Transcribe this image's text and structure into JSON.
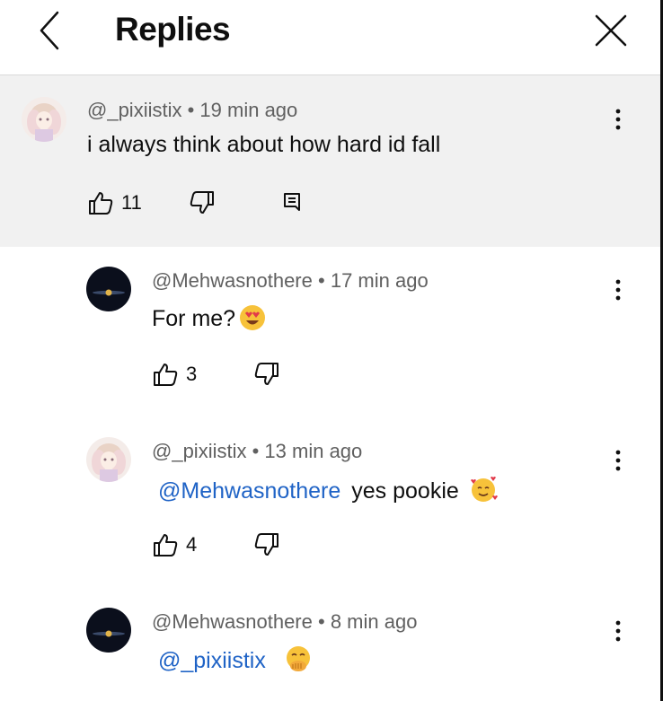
{
  "header": {
    "title": "Replies"
  },
  "comments": [
    {
      "author": "@_pixiistix",
      "time": "19 min ago",
      "text": "i always think about how hard id fall",
      "likes": "11",
      "avatar": "pastel-anime-avatar"
    },
    {
      "author": "@Mehwasnothere",
      "time": "17 min ago",
      "text": "For me?",
      "emoji": "heart-eyes-emoji",
      "likes": "3",
      "avatar": "dark-planet-avatar"
    },
    {
      "author": "@_pixiistix",
      "time": "13 min ago",
      "mention": "@Mehwasnothere",
      "text": "yes pookie",
      "emoji": "smiling-face-with-hearts-emoji",
      "likes": "4",
      "avatar": "pastel-anime-avatar"
    },
    {
      "author": "@Mehwasnothere",
      "time": "8 min ago",
      "mention": "@_pixiistix",
      "text": "",
      "emoji": "hand-over-mouth-emoji",
      "avatar": "dark-planet-avatar"
    }
  ],
  "colors": {
    "mention": "#1f63c6",
    "parent_bg": "#f1f1f1",
    "meta": "#606060"
  },
  "separator": "•"
}
